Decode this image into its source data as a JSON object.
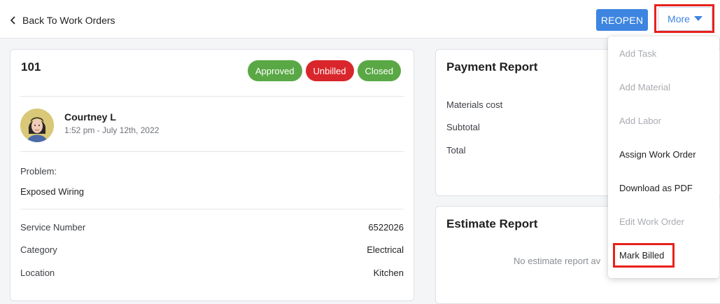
{
  "header": {
    "back_label": "Back To Work Orders",
    "reopen_label": "REOPEN",
    "more_label": "More"
  },
  "work_order": {
    "number": "101",
    "badges": [
      {
        "label": "Approved",
        "color": "#5aa845"
      },
      {
        "label": "Unbilled",
        "color": "#d9262c"
      },
      {
        "label": "Closed",
        "color": "#5aa845"
      }
    ],
    "user": {
      "name": "Courtney L",
      "time": "1:52 pm - July 12th, 2022"
    },
    "problem_label": "Problem:",
    "problem_value": "Exposed Wiring",
    "fields": [
      {
        "key": "Service Number",
        "value": "6522026"
      },
      {
        "key": "Category",
        "value": "Electrical"
      },
      {
        "key": "Location",
        "value": "Kitchen"
      }
    ]
  },
  "payment_report": {
    "title": "Payment Report",
    "lines": [
      "Materials cost",
      "Subtotal",
      "Total"
    ]
  },
  "estimate_report": {
    "title": "Estimate Report",
    "empty_text": "No estimate report av"
  },
  "more_menu": {
    "items": [
      {
        "label": "Add Task",
        "enabled": false
      },
      {
        "label": "Add Material",
        "enabled": false
      },
      {
        "label": "Add Labor",
        "enabled": false
      },
      {
        "label": "Assign Work Order",
        "enabled": true
      },
      {
        "label": "Download as PDF",
        "enabled": true
      },
      {
        "label": "Edit Work Order",
        "enabled": false
      },
      {
        "label": "Mark Billed",
        "enabled": true
      }
    ]
  },
  "icons": {
    "back": "chevron-left-icon",
    "more": "caret-down-icon"
  },
  "colors": {
    "primary": "#3d85e0",
    "highlight": "#e8211c",
    "green": "#5aa845",
    "red": "#d9262c"
  }
}
